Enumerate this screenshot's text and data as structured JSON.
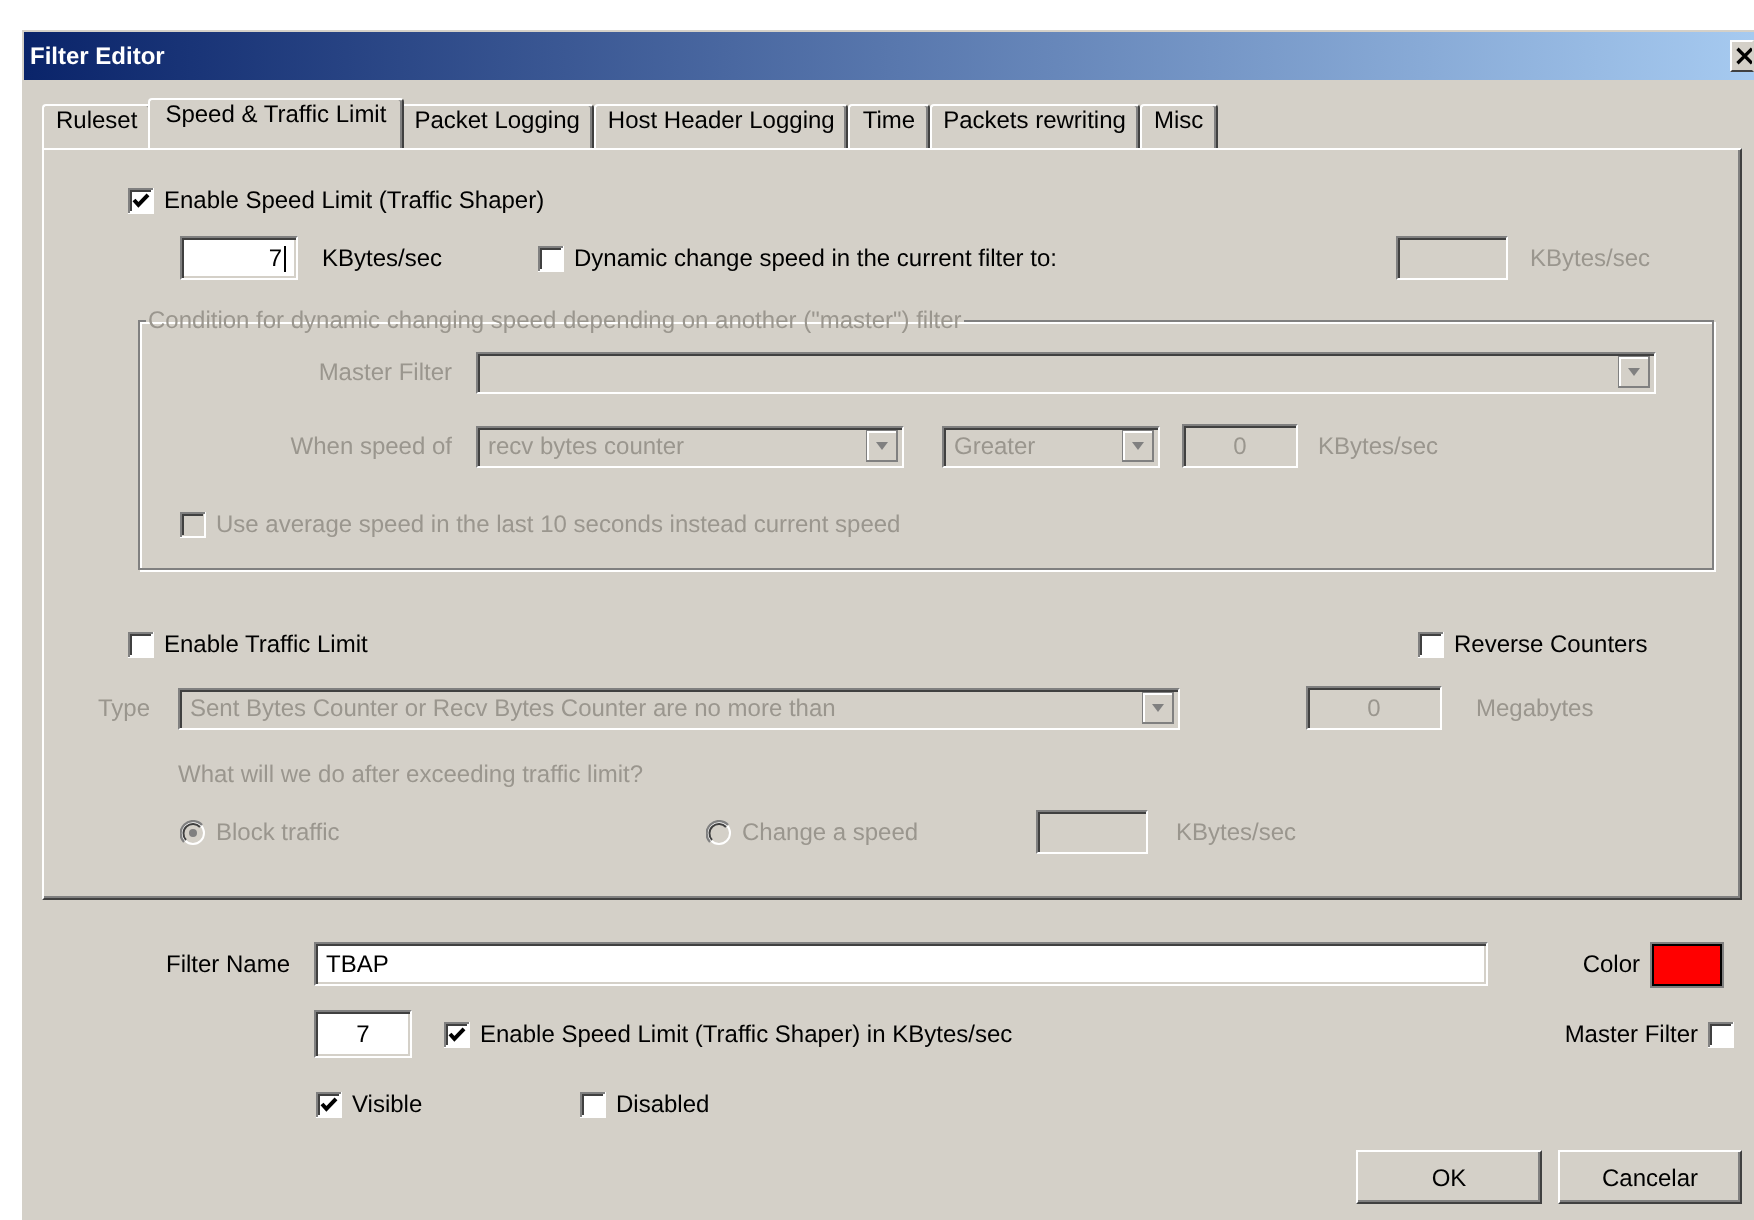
{
  "window": {
    "title": "Filter Editor"
  },
  "tabs": [
    {
      "label": "Ruleset",
      "selected": false
    },
    {
      "label": "Speed & Traffic Limit",
      "selected": true
    },
    {
      "label": "Packet Logging",
      "selected": false
    },
    {
      "label": "Host Header Logging",
      "selected": false
    },
    {
      "label": "Time",
      "selected": false
    },
    {
      "label": "Packets rewriting",
      "selected": false
    },
    {
      "label": "Misc",
      "selected": false
    }
  ],
  "speed_limit": {
    "enable": {
      "label": "Enable Speed Limit (Traffic Shaper)",
      "checked": true
    },
    "value": "7",
    "unit": "KBytes/sec",
    "dynamic": {
      "label": "Dynamic change speed in the current filter to:",
      "checked": false
    },
    "dynamic_speed": {
      "unit": "KBytes/sec",
      "disabled": true
    }
  },
  "condition": {
    "title": "Condition for dynamic changing speed depending on another (\"master\") filter",
    "disabled": true,
    "master_filter_label": "Master Filter",
    "when_speed_label": "When speed of",
    "counter": "recv bytes counter",
    "comparison": "Greater",
    "threshold": "0",
    "unit": "KBytes/sec",
    "average": {
      "label": "Use average speed in the last 10 seconds instead current speed",
      "checked": false
    }
  },
  "traffic_limit": {
    "enable": {
      "label": "Enable Traffic Limit",
      "checked": false
    },
    "reverse": {
      "label": "Reverse Counters",
      "checked": false
    },
    "disabled": true,
    "type_label": "Type",
    "type": "Sent Bytes Counter or Recv Bytes Counter are no more than",
    "amount": "0",
    "amount_unit": "Megabytes",
    "question": "What will we do after exceeding traffic limit?",
    "actions": [
      {
        "label": "Block traffic",
        "selected": true
      },
      {
        "label": "Change a speed",
        "selected": false
      }
    ],
    "action_unit": "KBytes/sec"
  },
  "filter": {
    "name_label": "Filter Name",
    "name": "TBAP",
    "color_label": "Color",
    "color": "#ff0000",
    "speed": "7",
    "speed_limit": {
      "label": "Enable Speed Limit (Traffic Shaper) in KBytes/sec",
      "checked": true
    },
    "master": {
      "label": "Master Filter",
      "checked": false
    },
    "visible": {
      "label": "Visible",
      "checked": true
    },
    "disabled": {
      "label": "Disabled",
      "checked": false
    }
  },
  "buttons": [
    {
      "label": "OK"
    },
    {
      "label": "Cancelar"
    }
  ]
}
